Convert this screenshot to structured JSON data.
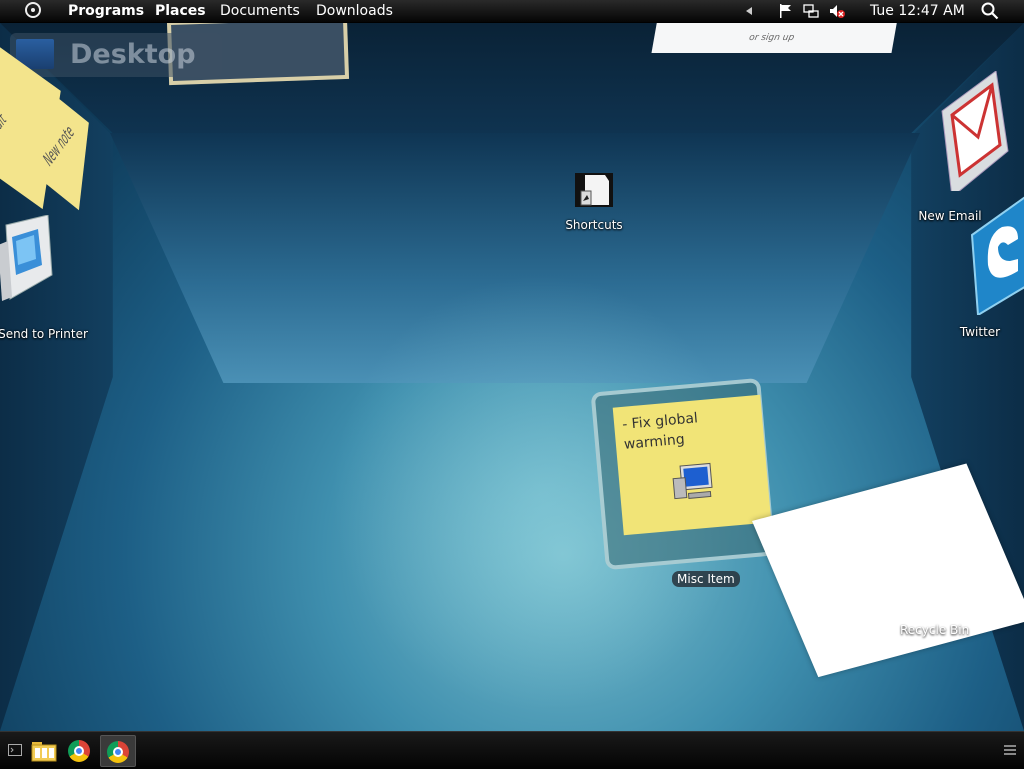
{
  "top_panel": {
    "menus": [
      "Programs",
      "Places",
      "Documents",
      "Downloads"
    ],
    "clock": "Tue 12:47 AM",
    "tray_icons": [
      "arrow-left-icon",
      "flag-icon",
      "network-icon",
      "volume-muted-icon",
      "search-icon"
    ]
  },
  "desktop": {
    "title": "Desktop",
    "web_card_text": "or sign up",
    "notes": {
      "edit_note": "edit",
      "new_note": "New note"
    },
    "icons": {
      "printer": "Send to Printer",
      "shortcuts": "Shortcuts",
      "email": "New Email",
      "twitter": "Twitter"
    },
    "misc_stack": {
      "note_text": "- Fix global\nwarming",
      "label": "Misc Item"
    },
    "recycle_bin": "Recycle Bin"
  },
  "taskbar": {
    "items": [
      "terminal-icon",
      "file-manager-icon",
      "chrome-icon",
      "chrome-icon-active"
    ],
    "menu_icon": "hamburger-icon"
  }
}
